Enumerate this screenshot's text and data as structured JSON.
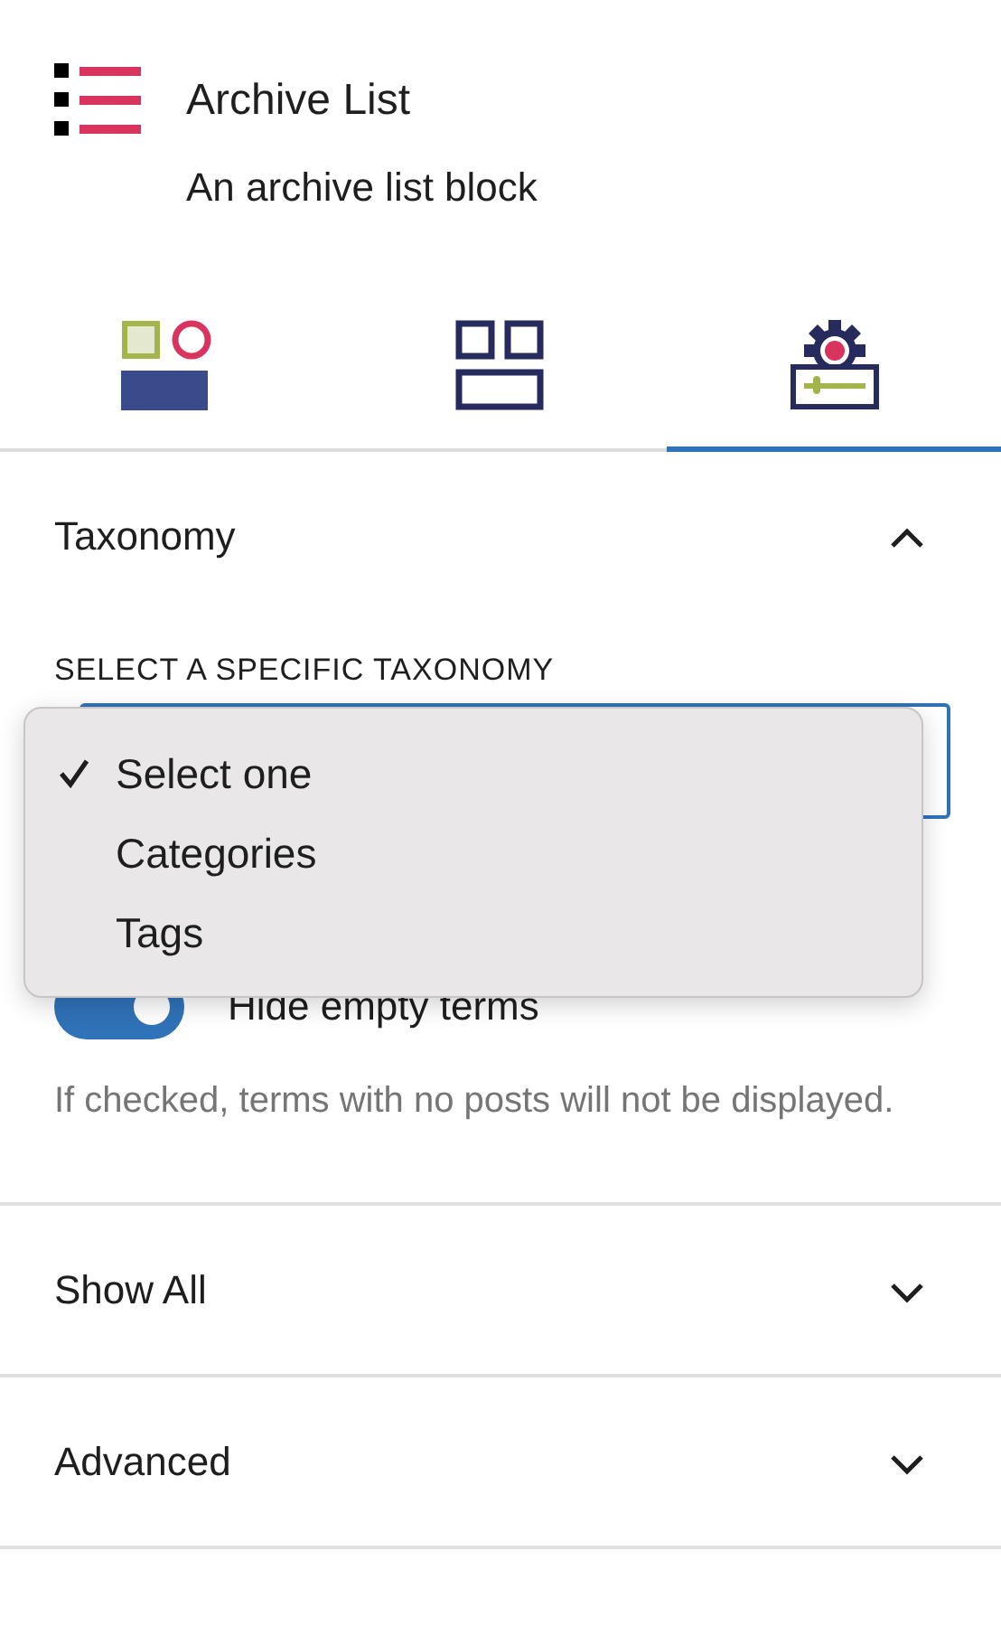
{
  "block": {
    "title": "Archive List",
    "description": "An archive list block"
  },
  "tabs": [
    {
      "kind": "styles",
      "selected": false
    },
    {
      "kind": "layout",
      "selected": false
    },
    {
      "kind": "settings",
      "selected": true
    }
  ],
  "panels": [
    {
      "title": "Taxonomy",
      "expanded": true,
      "select": {
        "label": "SELECT A SPECIFIC TAXONOMY",
        "options": [
          {
            "label": "Select one",
            "selected": true
          },
          {
            "label": "Categories",
            "selected": false
          },
          {
            "label": "Tags",
            "selected": false
          }
        ]
      },
      "toggle": {
        "label": "Hide empty terms",
        "on": true,
        "help": "If checked, terms with no posts will not be displayed."
      }
    },
    {
      "title": "Show All",
      "expanded": false
    },
    {
      "title": "Advanced",
      "expanded": false
    }
  ]
}
